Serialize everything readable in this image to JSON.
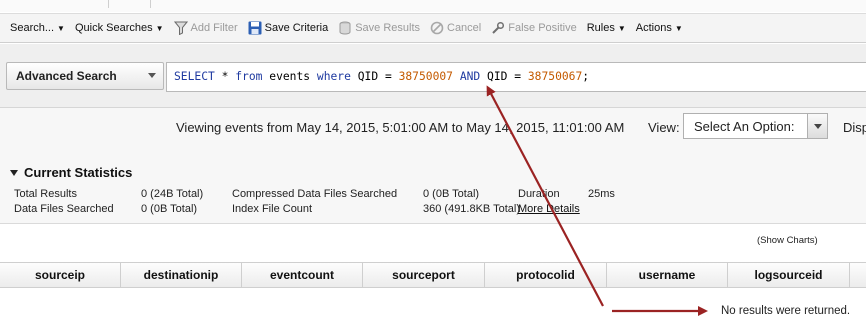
{
  "toolbar": {
    "search_label": "Search...",
    "quick_searches_label": "Quick Searches",
    "add_filter_label": "Add Filter",
    "save_criteria_label": "Save Criteria",
    "save_results_label": "Save Results",
    "cancel_label": "Cancel",
    "false_positive_label": "False Positive",
    "rules_label": "Rules",
    "actions_label": "Actions"
  },
  "search": {
    "mode_label": "Advanced Search",
    "query": {
      "kw_select": "SELECT",
      "star": "*",
      "kw_from": "from",
      "table": "events",
      "kw_where": "where",
      "field1": "QID",
      "eq1": "=",
      "val1": "38750007",
      "kw_and": "AND",
      "field2": "QID",
      "eq2": "=",
      "val2": "38750067",
      "end": ";"
    }
  },
  "viewing": {
    "text": "Viewing events from May 14, 2015, 5:01:00 AM to May 14, 2015, 11:01:00 AM",
    "view_label": "View:",
    "view_selected": "Select An Option:",
    "disp_text": "Disp"
  },
  "stats": {
    "title": "Current Statistics",
    "total_results_label": "Total Results",
    "total_results_value": "0 (24B Total)",
    "data_files_label": "Data Files Searched",
    "data_files_value": "0 (0B Total)",
    "compressed_label": "Compressed Data Files Searched",
    "compressed_value": "0 (0B Total)",
    "index_label": "Index File Count",
    "index_value": "360 (491.8KB Total)",
    "duration_label": "Duration",
    "duration_value": "25ms",
    "more_details": "More Details"
  },
  "charts": {
    "show_charts": "(Show Charts)"
  },
  "table": {
    "columns": [
      "sourceip",
      "destinationip",
      "eventcount",
      "sourceport",
      "protocolid",
      "username",
      "logsourceid"
    ],
    "empty_message": "No results were returned."
  },
  "colors": {
    "keyword": "#1f3aa0",
    "number": "#c45a00",
    "annotation_arrow": "#9b2323"
  }
}
